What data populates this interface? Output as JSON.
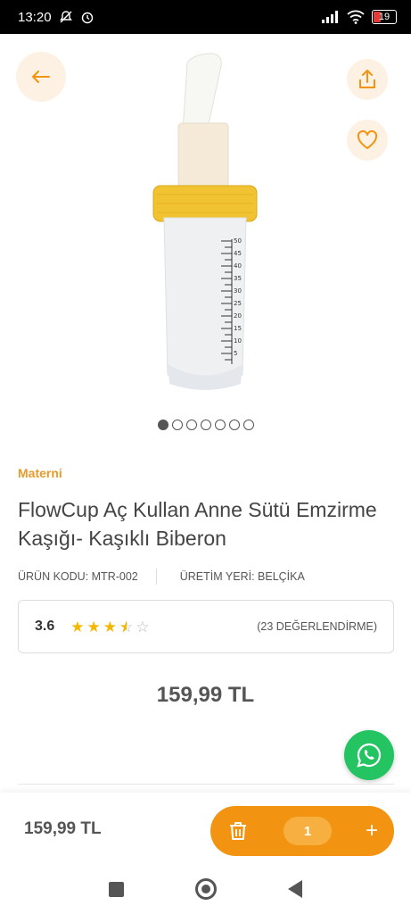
{
  "status_bar": {
    "time": "13:20",
    "battery": "19"
  },
  "product": {
    "image_count": 7,
    "active_image_index": 0,
    "brand": "Materni",
    "title": "FlowCup Aç Kullan Anne Sütü Emzirme Kaşığı- Kaşıklı Biberon",
    "product_code": "ÜRÜN KODU: MTR-002",
    "origin": "ÜRETİM YERİ: BELÇİKA",
    "rating": "3.6",
    "rating_value": 3.6,
    "rating_max": 5,
    "review_count": "(23 DEĞERLENDİRME)",
    "price": "159,99 TL"
  },
  "cart": {
    "price": "159,99 TL",
    "quantity": "1",
    "plus": "+"
  },
  "colors": {
    "accent": "#f29411",
    "brand": "#e89a2b",
    "whatsapp": "#25c463",
    "cap": "#f1c232"
  },
  "icons": [
    "arrow-left-icon",
    "share-icon",
    "heart-icon",
    "whatsapp-icon",
    "trash-icon",
    "plus-icon"
  ]
}
